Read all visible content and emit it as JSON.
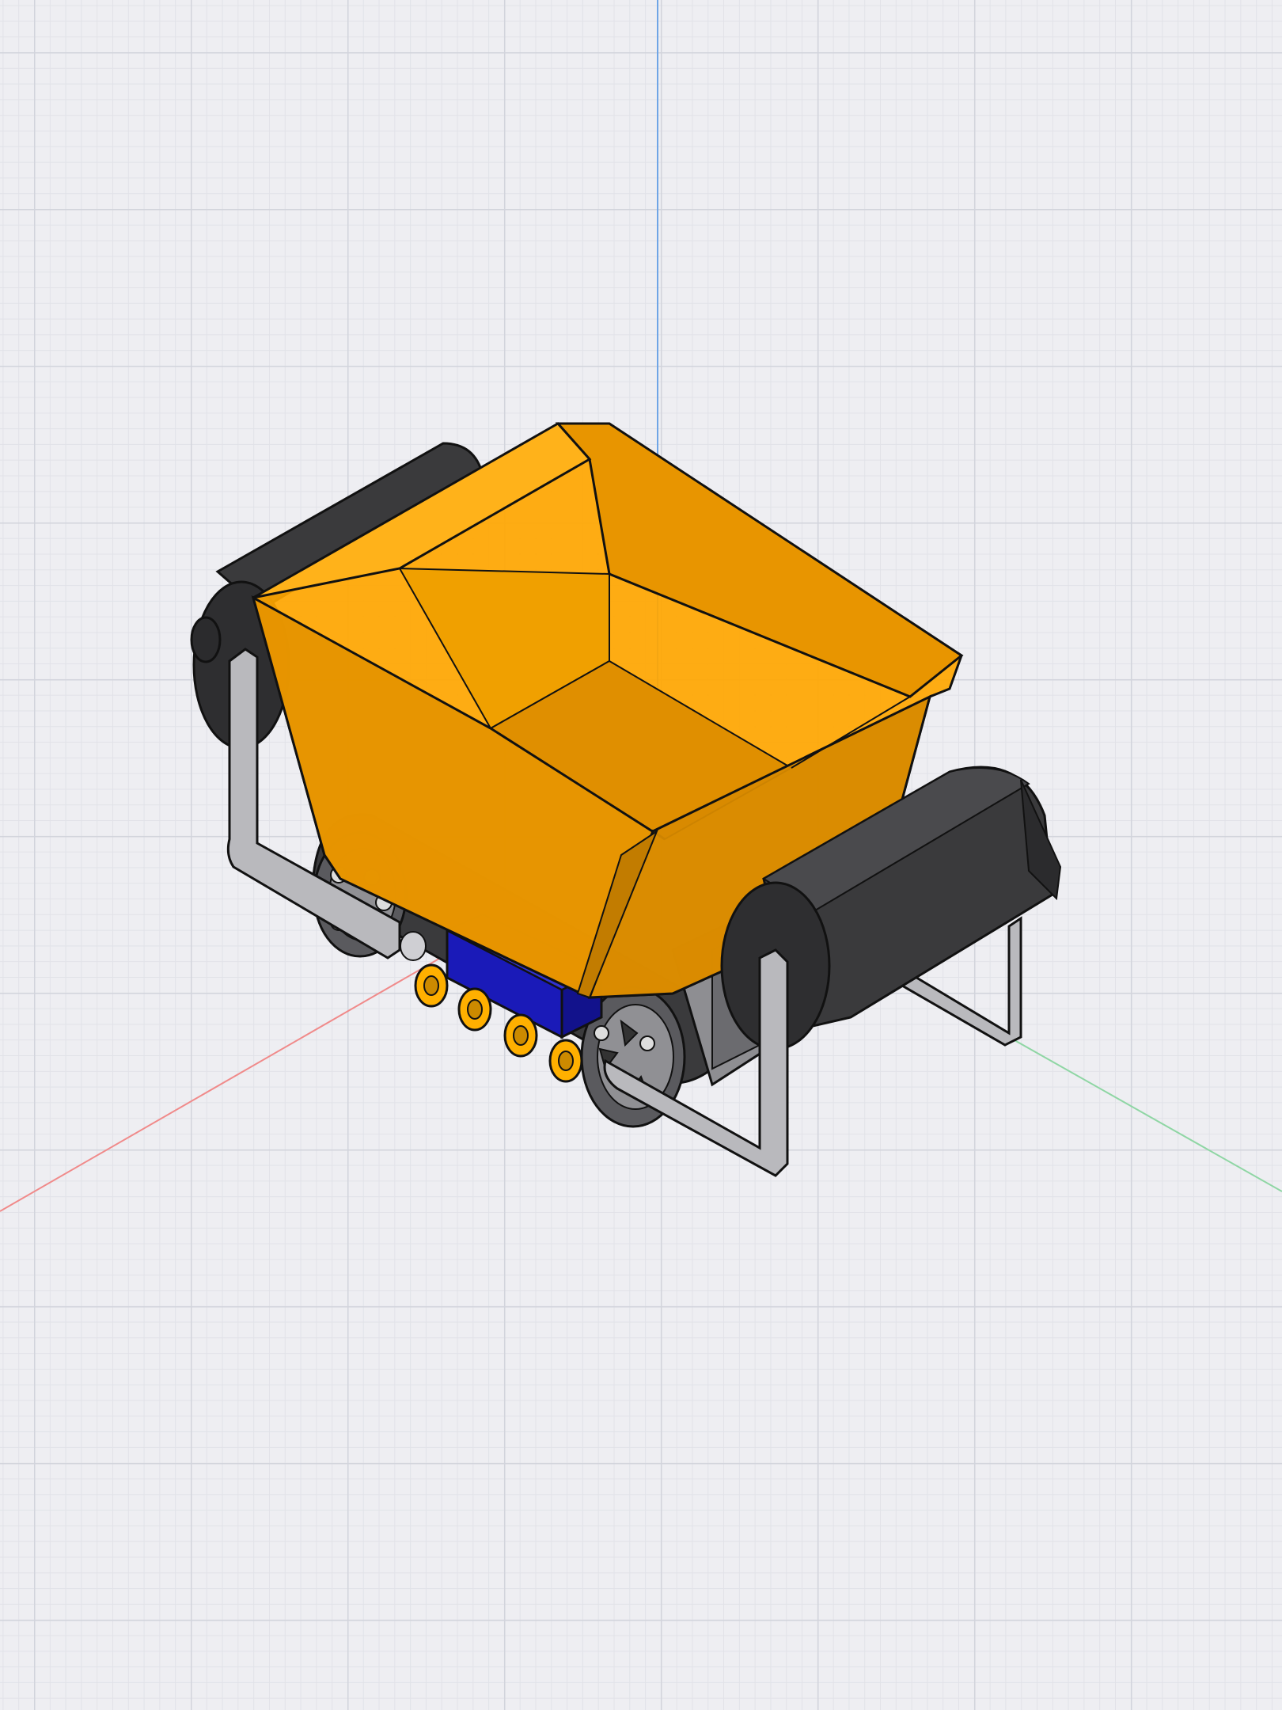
{
  "viewport": {
    "background_color": "#eeeef2",
    "grid_color": "#d2d4dc"
  },
  "axes": {
    "x_color": "#f08a8a",
    "y_color": "#8fd6a4",
    "z_color": "#6fa5e6"
  },
  "model": {
    "bucket_color": "#ffa600",
    "track_color": "#3a3a3c",
    "frame_color": "#b9b9bd",
    "motor_color": "#1a1ab8",
    "roller_color": "#ffb000"
  }
}
